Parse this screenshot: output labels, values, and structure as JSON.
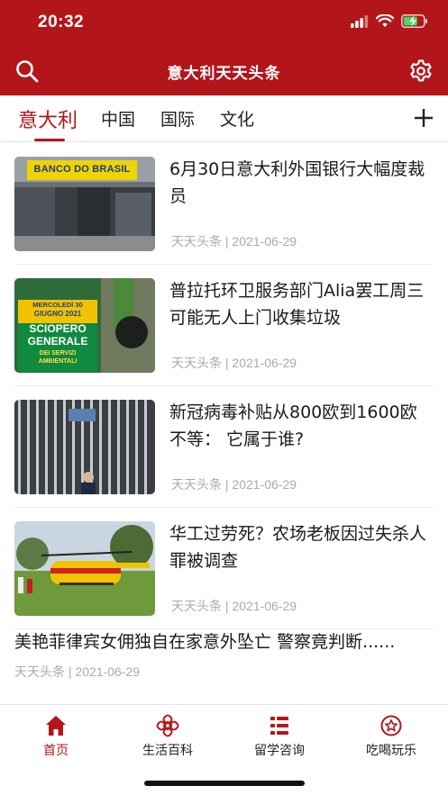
{
  "status": {
    "time": "20:32"
  },
  "header": {
    "title": "意大利天天头条"
  },
  "tabs": [
    {
      "label": "意大利",
      "active": true
    },
    {
      "label": "中国"
    },
    {
      "label": "国际"
    },
    {
      "label": "文化"
    }
  ],
  "news": [
    {
      "title": "6月30日意大利外国银行大幅度裁员",
      "meta": "天天头条 | 2021-06-29",
      "thumb_text": "BANCO DO BRASIL"
    },
    {
      "title": "普拉托环卫服务部门Alia罢工周三可能无人上门收集垃圾",
      "meta": "天天头条 | 2021-06-29",
      "thumb_text": [
        "MERCOLEDÌ 30",
        "GIUGNO 2021",
        "SCIOPERO",
        "GENERALE",
        "DEI SERVIZI",
        "AMBIENTALI"
      ]
    },
    {
      "title": "新冠病毒补贴从800欧到1600欧不等： 它属于谁?",
      "meta": "天天头条 | 2021-06-29"
    },
    {
      "title": "华工过劳死？农场老板因过失杀人罪被调查",
      "meta": "天天头条 | 2021-06-29"
    }
  ],
  "text_news": {
    "title": "美艳菲律宾女佣独自在家意外坠亡 警察竟判断......",
    "meta": "天天头条 | 2021-06-29"
  },
  "bottom_tabs": [
    {
      "label": "首页",
      "icon": "home-icon",
      "active": true
    },
    {
      "label": "生活百科",
      "icon": "knot-icon"
    },
    {
      "label": "留学咨询",
      "icon": "list-icon"
    },
    {
      "label": "吃喝玩乐",
      "icon": "star-badge-icon"
    }
  ],
  "colors": {
    "brand": "#b3161a",
    "meta": "#aaaaaa"
  }
}
